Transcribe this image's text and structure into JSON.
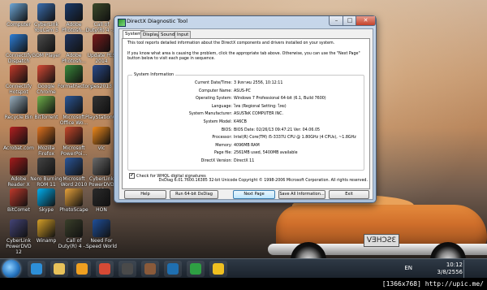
{
  "desktop": {
    "icons": [
      {
        "label": "Computer",
        "color": "#6fa8d8"
      },
      {
        "label": "CyberLink YouCam 5",
        "color": "#3b6fb0"
      },
      {
        "label": "Adobe Photosh...",
        "color": "#1a3a6b"
      },
      {
        "label": "Call of Duty(R) 4 -...",
        "color": "#3c4a2a"
      },
      {
        "label": "Connectify Dispatch",
        "color": "#2e7fd8"
      },
      {
        "label": "GOM Player",
        "color": "#4d4d4d"
      },
      {
        "label": "Adobe Photosh...",
        "color": "#20355f"
      },
      {
        "label": "Update PES 2014",
        "color": "#7a1b1b"
      },
      {
        "label": "Connectify Hotspot",
        "color": "#c23a2a"
      },
      {
        "label": "Google Chrome",
        "color": "#d64a35"
      },
      {
        "label": "FormatFactory",
        "color": "#3b8a3b"
      },
      {
        "label": "pes2013",
        "color": "#2a4a8a"
      },
      {
        "label": "Recycle Bin",
        "color": "#9ab0c0"
      },
      {
        "label": "BitTorrent",
        "color": "#6fb04a"
      },
      {
        "label": "Microsoft Office Wo...",
        "color": "#2b5797"
      },
      {
        "label": "PlayStation(R)...",
        "color": "#333333"
      },
      {
        "label": "Acrobat.com",
        "color": "#b32020"
      },
      {
        "label": "Mozilla Firefox",
        "color": "#e0731f"
      },
      {
        "label": "Microsoft PowerPoi...",
        "color": "#c7472a"
      },
      {
        "label": "vlc",
        "color": "#f08a1c"
      },
      {
        "label": "Adobe Reader X",
        "color": "#a51b1b"
      },
      {
        "label": "Nero Burning ROM 11",
        "color": "#444444"
      },
      {
        "label": "Microsoft Word 2010",
        "color": "#2b579a"
      },
      {
        "label": "CyberLink PowerDVD 12",
        "color": "#6b6b6b"
      },
      {
        "label": "BitComet",
        "color": "#c0392b"
      },
      {
        "label": "Skype",
        "color": "#00aff0"
      },
      {
        "label": "PhotoScape",
        "color": "#e7a23b"
      },
      {
        "label": "HON",
        "color": "#2a2a2a"
      },
      {
        "label": "CyberLink PowerDVD 12",
        "color": "#444477"
      },
      {
        "label": "Winamp",
        "color": "#d6a028"
      },
      {
        "label": "Call of Duty(R) 4 -...",
        "color": "#3a3f2a"
      },
      {
        "label": "Need For Speed World",
        "color": "#1f4f9a"
      }
    ]
  },
  "dialog": {
    "title": "DirectX Diagnostic Tool",
    "close_glyph": "✕",
    "min_glyph": "–",
    "max_glyph": "□",
    "tabs": [
      "System",
      "Display",
      "Sound",
      "Input"
    ],
    "intro": "This tool reports detailed information about the DirectX components and drivers installed on your system.",
    "instructions": "If you know what area is causing the problem, click the appropriate tab above. Otherwise, you can use the \"Next Page\" button below to visit each page in sequence.",
    "group_title": "System Information",
    "rows": [
      {
        "k": "Current Date/Time:",
        "v": "3 สิงหาคม 2556, 10:12:11"
      },
      {
        "k": "Computer Name:",
        "v": "ASUS-PC"
      },
      {
        "k": "Operating System:",
        "v": "Windows 7 Professional 64-bit (6.1, Build 7600)"
      },
      {
        "k": "Language:",
        "v": "ไทย (Regional Setting: ไทย)"
      },
      {
        "k": "System Manufacturer:",
        "v": "ASUSTeK COMPUTER INC."
      },
      {
        "k": "System Model:",
        "v": "K46CB"
      },
      {
        "k": "BIOS:",
        "v": "BIOS Date: 02/26/13 09:47:21 Ver: 04.06.05"
      },
      {
        "k": "Processor:",
        "v": "Intel(R) Core(TM) i5-3337U CPU @ 1.80GHz (4 CPUs), ~1.8GHz"
      },
      {
        "k": "Memory:",
        "v": "4096MB RAM"
      },
      {
        "k": "Page file:",
        "v": "2561MB used, 5400MB available"
      },
      {
        "k": "DirectX Version:",
        "v": "DirectX 11"
      }
    ],
    "whql_label": "Check for WHQL digital signatures",
    "whql_checked": "✔",
    "copyright": "DxDiag 6.01.7600.16385 32-bit Unicode  Copyright © 1998-2006 Microsoft Corporation.  All rights reserved.",
    "buttons": {
      "help": "Help",
      "run64": "Run 64-bit DxDiag",
      "next": "Next Page",
      "save": "Save All Information...",
      "exit": "Exit"
    }
  },
  "taskbar": {
    "items": [
      {
        "name": "ie",
        "color": "#2d8fd8"
      },
      {
        "name": "explorer",
        "color": "#e8c25a"
      },
      {
        "name": "media-player",
        "color": "#f0a020"
      },
      {
        "name": "chrome",
        "color": "#d64a35"
      },
      {
        "name": "hon",
        "color": "#4a4a4a"
      },
      {
        "name": "game",
        "color": "#8a5a3a"
      },
      {
        "name": "nfs",
        "color": "#1f6fb0"
      },
      {
        "name": "line",
        "color": "#2ea043"
      },
      {
        "name": "xfire",
        "color": "#f0c020"
      }
    ],
    "lang": "EN",
    "time": "10:12",
    "date": "3/8/2556"
  },
  "watermark": "[1366x768] http://upic.me/"
}
